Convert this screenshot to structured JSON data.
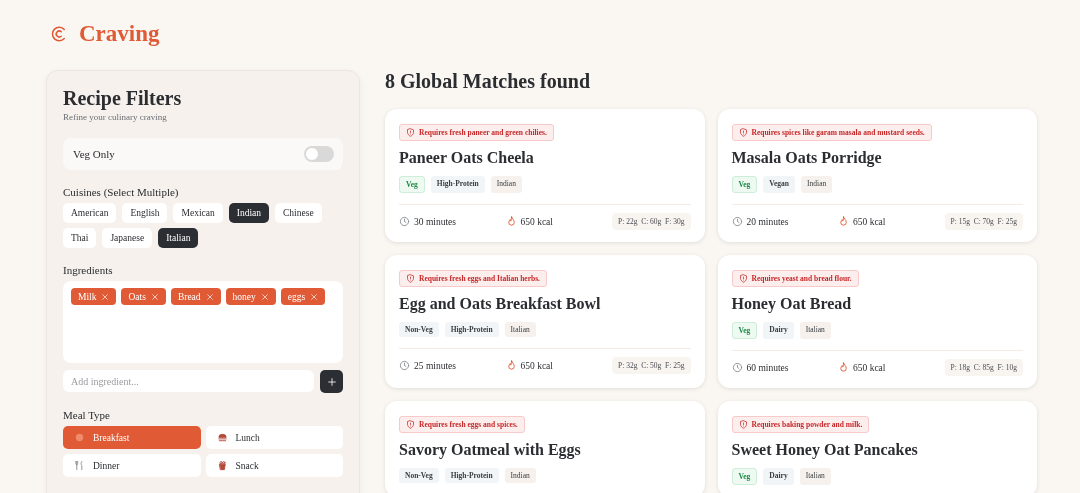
{
  "brand": {
    "name": "Craving"
  },
  "filters": {
    "title": "Recipe Filters",
    "subtitle": "Refine your culinary craving",
    "veg_only": {
      "label": "Veg Only",
      "on": false
    },
    "cuisines": {
      "label": "Cuisines (Select Multiple)",
      "items": [
        {
          "label": "American",
          "selected": false
        },
        {
          "label": "English",
          "selected": false
        },
        {
          "label": "Mexican",
          "selected": false
        },
        {
          "label": "Indian",
          "selected": true
        },
        {
          "label": "Chinese",
          "selected": false
        },
        {
          "label": "Thai",
          "selected": false
        },
        {
          "label": "Japanese",
          "selected": false
        },
        {
          "label": "Italian",
          "selected": true
        }
      ]
    },
    "ingredients": {
      "label": "Ingredients",
      "items": [
        "Milk",
        "Oats",
        "Bread",
        "honey",
        "eggs"
      ],
      "placeholder": "Add ingredient..."
    },
    "meal_type": {
      "label": "Meal Type",
      "items": [
        {
          "label": "Breakfast",
          "kind": "breakfast",
          "selected": true
        },
        {
          "label": "Lunch",
          "kind": "lunch",
          "selected": false
        },
        {
          "label": "Dinner",
          "kind": "dinner",
          "selected": false
        },
        {
          "label": "Snack",
          "kind": "snack",
          "selected": false
        }
      ]
    }
  },
  "results": {
    "title": "8 Global Matches found",
    "recipes": [
      {
        "warning": "Requires fresh paneer and green chilies.",
        "title": "Paneer Oats Cheela",
        "tags": [
          {
            "label": "Veg",
            "kind": "veg"
          },
          {
            "label": "High-Protein",
            "kind": "attribute"
          },
          {
            "label": "Indian",
            "kind": "cuisine"
          }
        ],
        "time": "30 minutes",
        "calories": "650 kcal",
        "macros": "P: 22g  C: 60g  F: 30g"
      },
      {
        "warning": "Requires spices like garam masala and mustard seeds.",
        "title": "Masala Oats Porridge",
        "tags": [
          {
            "label": "Veg",
            "kind": "veg"
          },
          {
            "label": "Vegan",
            "kind": "attribute"
          },
          {
            "label": "Indian",
            "kind": "cuisine"
          }
        ],
        "time": "20 minutes",
        "calories": "650 kcal",
        "macros": "P: 15g  C: 70g  F: 25g"
      },
      {
        "warning": "Requires fresh eggs and Italian herbs.",
        "title": "Egg and Oats Breakfast Bowl",
        "tags": [
          {
            "label": "Non-Veg",
            "kind": "attribute"
          },
          {
            "label": "High-Protein",
            "kind": "attribute"
          },
          {
            "label": "Italian",
            "kind": "cuisine"
          }
        ],
        "time": "25 minutes",
        "calories": "650 kcal",
        "macros": "P: 32g  C: 50g  F: 25g"
      },
      {
        "warning": "Requires yeast and bread flour.",
        "title": "Honey Oat Bread",
        "tags": [
          {
            "label": "Veg",
            "kind": "veg"
          },
          {
            "label": "Dairy",
            "kind": "attribute"
          },
          {
            "label": "Italian",
            "kind": "cuisine"
          }
        ],
        "time": "60 minutes",
        "calories": "650 kcal",
        "macros": "P: 18g  C: 85g  F: 10g"
      },
      {
        "warning": "Requires fresh eggs and spices.",
        "title": "Savory Oatmeal with Eggs",
        "tags": [
          {
            "label": "Non-Veg",
            "kind": "attribute"
          },
          {
            "label": "High-Protein",
            "kind": "attribute"
          },
          {
            "label": "Indian",
            "kind": "cuisine"
          }
        ]
      },
      {
        "warning": "Requires baking powder and milk.",
        "title": "Sweet Honey Oat Pancakes",
        "tags": [
          {
            "label": "Veg",
            "kind": "veg"
          },
          {
            "label": "Dairy",
            "kind": "attribute"
          },
          {
            "label": "Italian",
            "kind": "cuisine"
          }
        ]
      }
    ]
  }
}
